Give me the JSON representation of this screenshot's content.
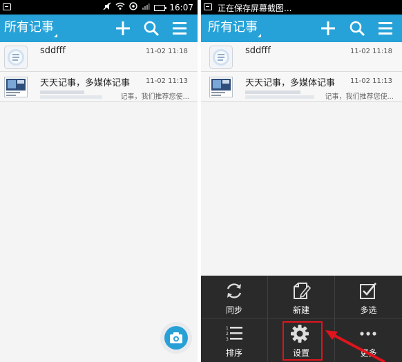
{
  "left_screen": {
    "status_time": "16:07",
    "app_title": "所有记事",
    "camera_button_icon": "camera-icon"
  },
  "right_screen": {
    "status_message": "正在保存屏幕截图...",
    "app_title": "所有记事"
  },
  "notes": [
    {
      "title": "sddfff",
      "date": "11-02 11:18",
      "snippet": ""
    },
    {
      "title": "天天记事，多媒体记事",
      "date": "11-02 11:13",
      "snippet": "记事，我们推荐您使..."
    }
  ],
  "menu": [
    {
      "label": "同步",
      "icon": "sync-icon"
    },
    {
      "label": "新建",
      "icon": "new-note-icon"
    },
    {
      "label": "多选",
      "icon": "multi-select-icon"
    },
    {
      "label": "排序",
      "icon": "sort-icon"
    },
    {
      "label": "设置",
      "icon": "settings-gear-icon"
    },
    {
      "label": "更多",
      "icon": "more-icon"
    }
  ],
  "colors": {
    "app_bar": "#26a2d8",
    "highlight": "#e0141c",
    "menu_bg": "#2a2a2a"
  }
}
